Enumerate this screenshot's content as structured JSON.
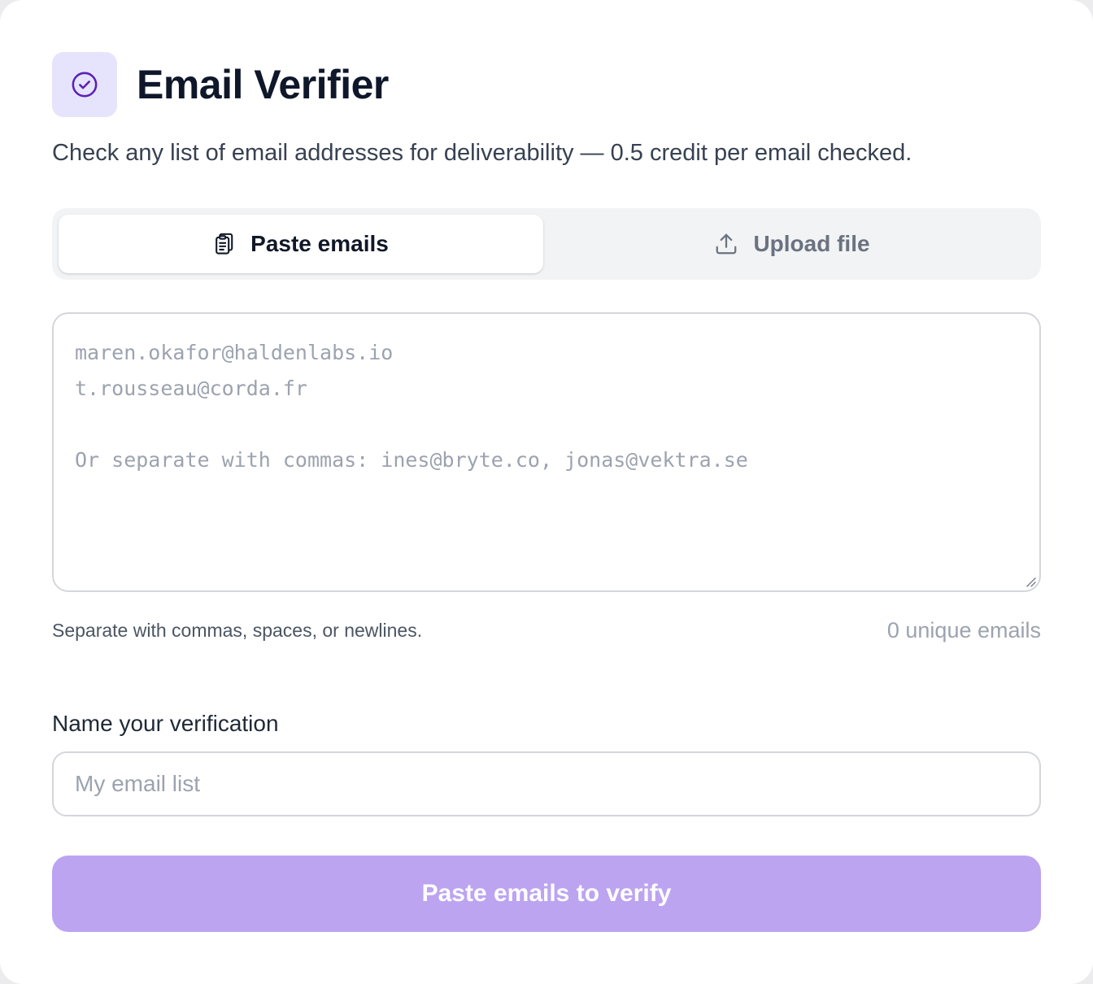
{
  "header": {
    "title": "Email Verifier",
    "subtitle": "Check any list of email addresses for deliverability — 0.5 credit per email checked.",
    "icon": "check-circle-icon"
  },
  "tabs": [
    {
      "label": "Paste emails",
      "icon": "clipboard-icon",
      "active": true
    },
    {
      "label": "Upload file",
      "icon": "upload-icon",
      "active": false
    }
  ],
  "emails_input": {
    "value": "",
    "placeholder_lines": [
      "maren.okafor@haldenlabs.io",
      "t.rousseau@corda.fr",
      "",
      "Or separate with commas: ines@bryte.co, jonas@vektra.se"
    ]
  },
  "hint": "Separate with commas, spaces, or newlines.",
  "unique_count": "0 unique emails",
  "name_field": {
    "label": "Name your verification",
    "placeholder": "My email list",
    "value": ""
  },
  "submit": {
    "label": "Paste emails to verify",
    "disabled": true
  },
  "colors": {
    "accent": "#6d28d9",
    "accent_soft": "#e6e4fd",
    "button_disabled": "#bca4f1"
  }
}
